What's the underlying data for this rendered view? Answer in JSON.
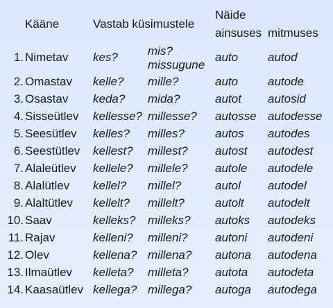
{
  "header": {
    "case": "Kääne",
    "answers": "Vastab küsimustele",
    "examples": "Näide",
    "singular": "ainsuses",
    "plural": "mitmuses"
  },
  "rows": [
    {
      "num": "1.",
      "name": "Nimetav",
      "q1": "kes?",
      "q2a": "mis?",
      "q2b": "missugune",
      "sg": "auto",
      "pl": "autod"
    },
    {
      "num": "2.",
      "name": "Omastav",
      "q1": "kelle?",
      "q2": "mille?",
      "sg": "auto",
      "pl": "autode"
    },
    {
      "num": "3.",
      "name": "Osastav",
      "q1": "keda?",
      "q2": "mida?",
      "sg": "autot",
      "pl": "autosid"
    },
    {
      "num": "4.",
      "name": "Sisseütlev",
      "q1": "kellesse?",
      "q2": "millesse?",
      "sg": "autosse",
      "pl": "autodesse"
    },
    {
      "num": "5.",
      "name": "Seesütlev",
      "q1": "kelles?",
      "q2": "milles?",
      "sg": "autos",
      "pl": "autodes"
    },
    {
      "num": "6.",
      "name": "Seestütlev",
      "q1": "kellest?",
      "q2": "millest?",
      "sg": "autost",
      "pl": "autodest"
    },
    {
      "num": "7.",
      "name": "Alaleütlev",
      "q1": "kellele?",
      "q2": "millele?",
      "sg": "autole",
      "pl": "autodele"
    },
    {
      "num": "8.",
      "name": "Alalütlev",
      "q1": "kellel?",
      "q2": "millel?",
      "sg": "autol",
      "pl": "autodel"
    },
    {
      "num": "9.",
      "name": "Alaltütlev",
      "q1": "kellelt?",
      "q2": "millelt?",
      "sg": "autolt",
      "pl": "autodelt"
    },
    {
      "num": "10.",
      "name": "Saav",
      "q1": "kelleks?",
      "q2": "milleks?",
      "sg": "autoks",
      "pl": "autodeks"
    },
    {
      "num": "11.",
      "name": "Rajav",
      "q1": "kelleni?",
      "q2": "milleni?",
      "sg": "autoni",
      "pl": "autodeni"
    },
    {
      "num": "12.",
      "name": "Olev",
      "q1": "kellena?",
      "q2": "millena?",
      "sg": "autona",
      "pl": "autodena"
    },
    {
      "num": "13.",
      "name": "Ilmaütlev",
      "q1": "kelleta?",
      "q2": "milleta?",
      "sg": "autota",
      "pl": "autodeta"
    },
    {
      "num": "14.",
      "name": "Kaasaütlev",
      "q1": "kellega?",
      "q2": "millega?",
      "sg": "autoga",
      "pl": "autodega"
    }
  ]
}
